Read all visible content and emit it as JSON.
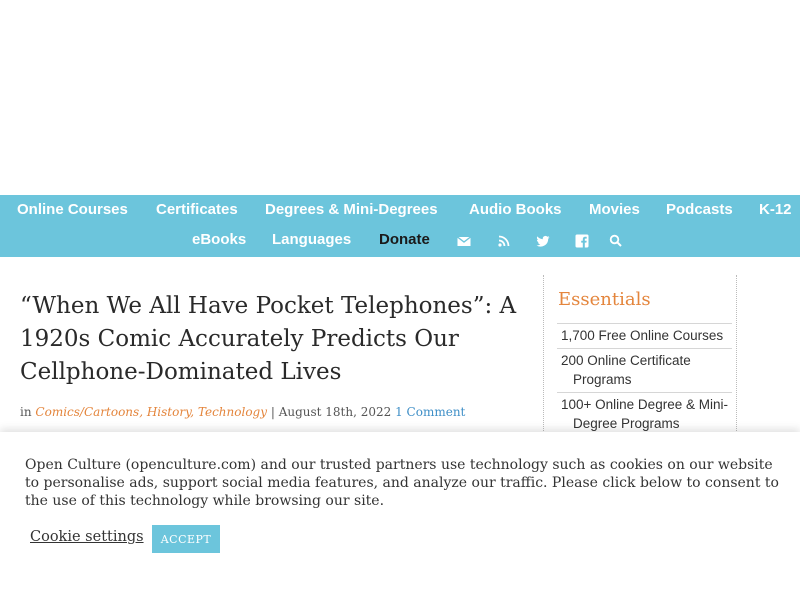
{
  "nav": {
    "row1": [
      "Online Courses",
      "Certificates",
      "Degrees & Mini-Degrees",
      "Audio Books",
      "Movies",
      "Podcasts",
      "K-12"
    ],
    "row2": [
      "eBooks",
      "Languages",
      "Donate"
    ],
    "icons": [
      "email-icon",
      "rss-icon",
      "twitter-icon",
      "facebook-icon",
      "search-icon"
    ]
  },
  "article": {
    "title": "“When We All Have Pocket Telephones”: A 1920s Comic Accurately Predicts Our Cellphone-Dominated Lives",
    "meta_prefix": "in",
    "categories": [
      "Comics/Cartoons",
      "History",
      "Technology"
    ],
    "date": "August 18th, 2022",
    "comments": "1 Comment"
  },
  "sidebar": {
    "title": "Essentials",
    "items": [
      "1,700 Free Online Courses",
      "200 Online Certificate Programs",
      "100+ Online Degree & Mini-Degree Programs"
    ]
  },
  "cookie": {
    "message": "Open Culture (openculture.com) and our trusted partners use technology such as cookies on our website to personalise ads, support social media features, and analyze our traffic. Please click below to consent to the use of this technology while browsing our site.",
    "settings_label": "Cookie settings",
    "accept_label": "ACCEPT"
  },
  "colors": {
    "nav_bg": "#6cc5dc",
    "accent_orange": "#e4853c",
    "link_blue": "#3f8fc7",
    "donate_text": "#1a1a1a"
  }
}
